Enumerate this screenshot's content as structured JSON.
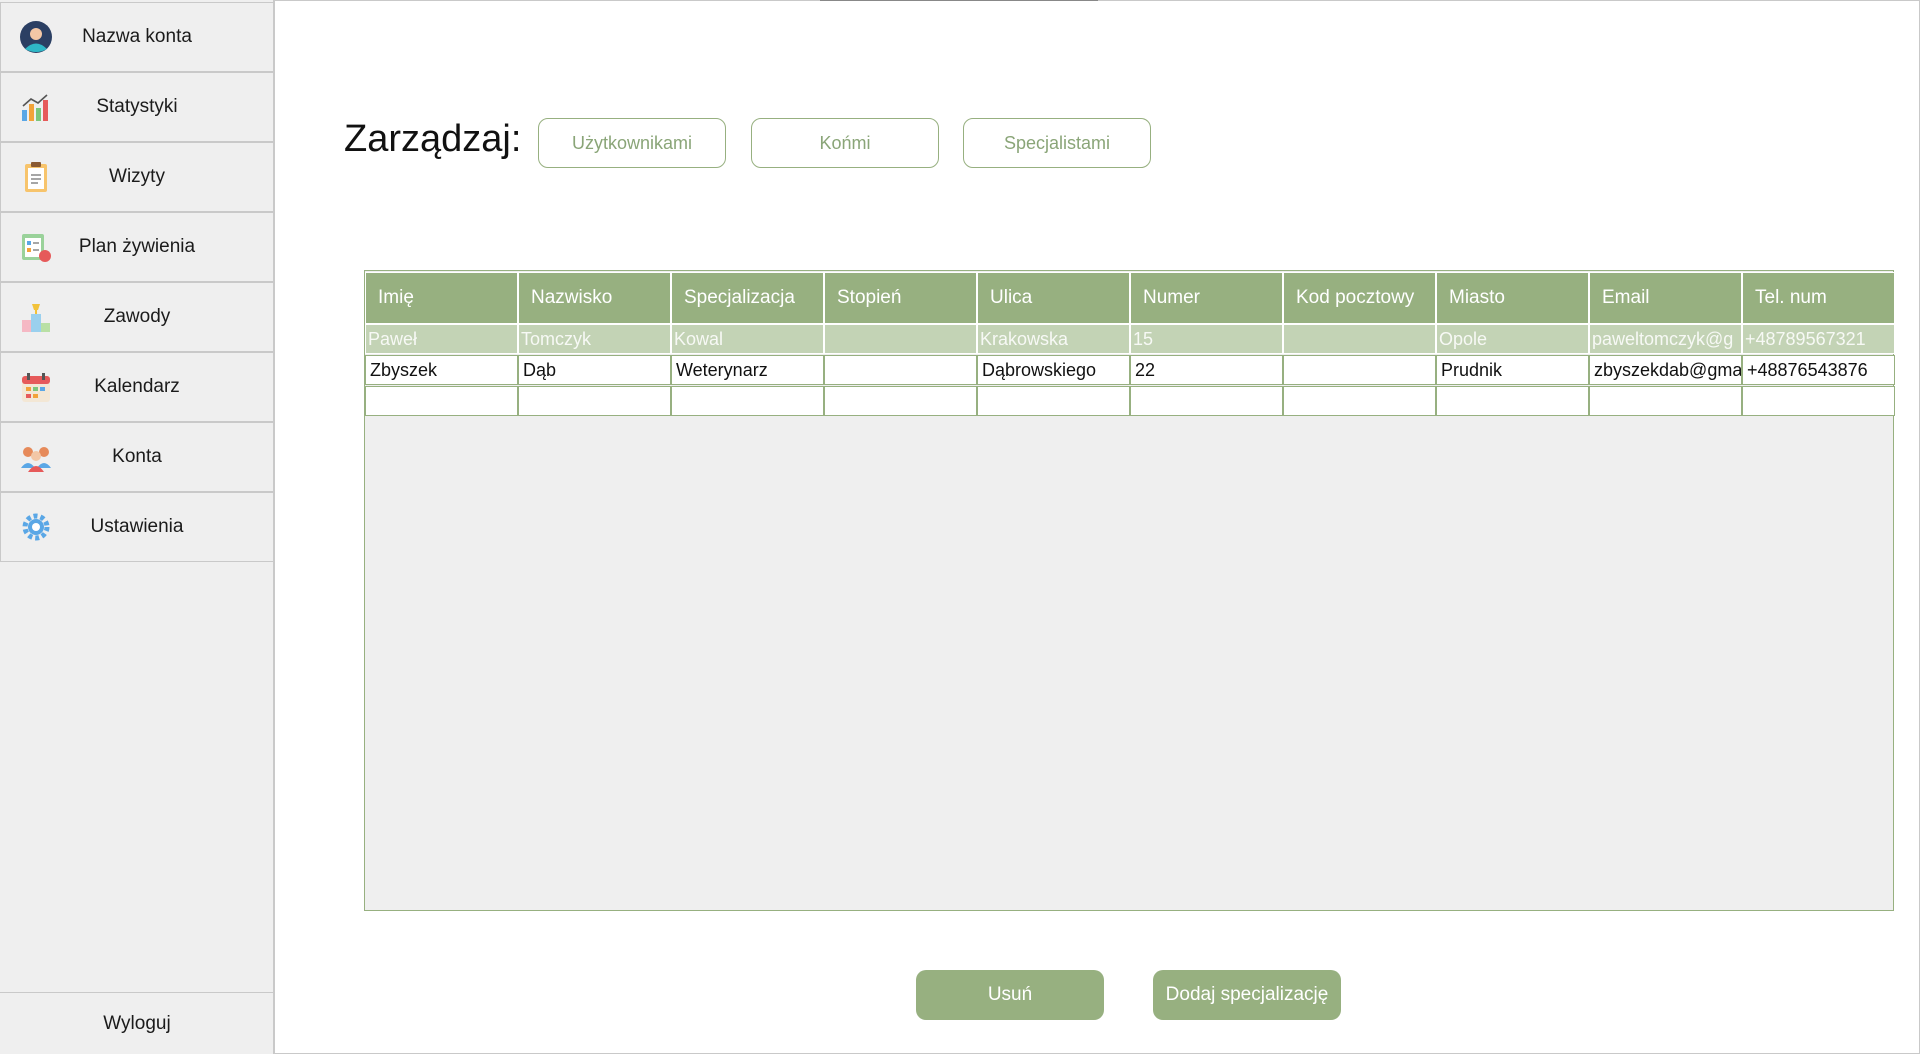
{
  "sidebar": {
    "items": [
      {
        "label": "Nazwa konta",
        "icon": "avatar-icon"
      },
      {
        "label": "Statystyki",
        "icon": "chart-icon"
      },
      {
        "label": "Wizyty",
        "icon": "clipboard-icon"
      },
      {
        "label": "Plan żywienia",
        "icon": "meal-plan-icon"
      },
      {
        "label": "Zawody",
        "icon": "podium-icon"
      },
      {
        "label": "Kalendarz",
        "icon": "calendar-icon"
      },
      {
        "label": "Konta",
        "icon": "users-icon"
      },
      {
        "label": "Ustawienia",
        "icon": "gear-icon"
      }
    ],
    "logout": "Wyloguj"
  },
  "main": {
    "manage_label": "Zarządzaj:",
    "tabs": [
      "Użytkownikami",
      "Końmi",
      "Specjalistami"
    ]
  },
  "table": {
    "columns": [
      "Imię",
      "Nazwisko",
      "Specjalizacja",
      "Stopień",
      "Ulica",
      "Numer",
      "Kod pocztowy",
      "Miasto",
      "Email",
      "Tel. num"
    ],
    "rows": [
      [
        "Paweł",
        "Tomczyk",
        "Kowal",
        "",
        "Krakowska",
        "15",
        "",
        "Opole",
        "paweltomczyk@g",
        "+48789567321"
      ],
      [
        "Zbyszek",
        "Dąb",
        "Weterynarz",
        "",
        "Dąbrowskiego",
        "22",
        "",
        "Prudnik",
        "zbyszekdab@gma",
        "+48876543876"
      ],
      [
        "",
        "",
        "",
        "",
        "",
        "",
        "",
        "",
        "",
        ""
      ]
    ],
    "selected_row": 0
  },
  "actions": {
    "delete_label": "Usuń",
    "add_specialization_label": "Dodaj specjalizację"
  },
  "colors": {
    "accent": "#97b080",
    "selected_row": "#c3d3b5",
    "sidebar_bg": "#efefef"
  }
}
